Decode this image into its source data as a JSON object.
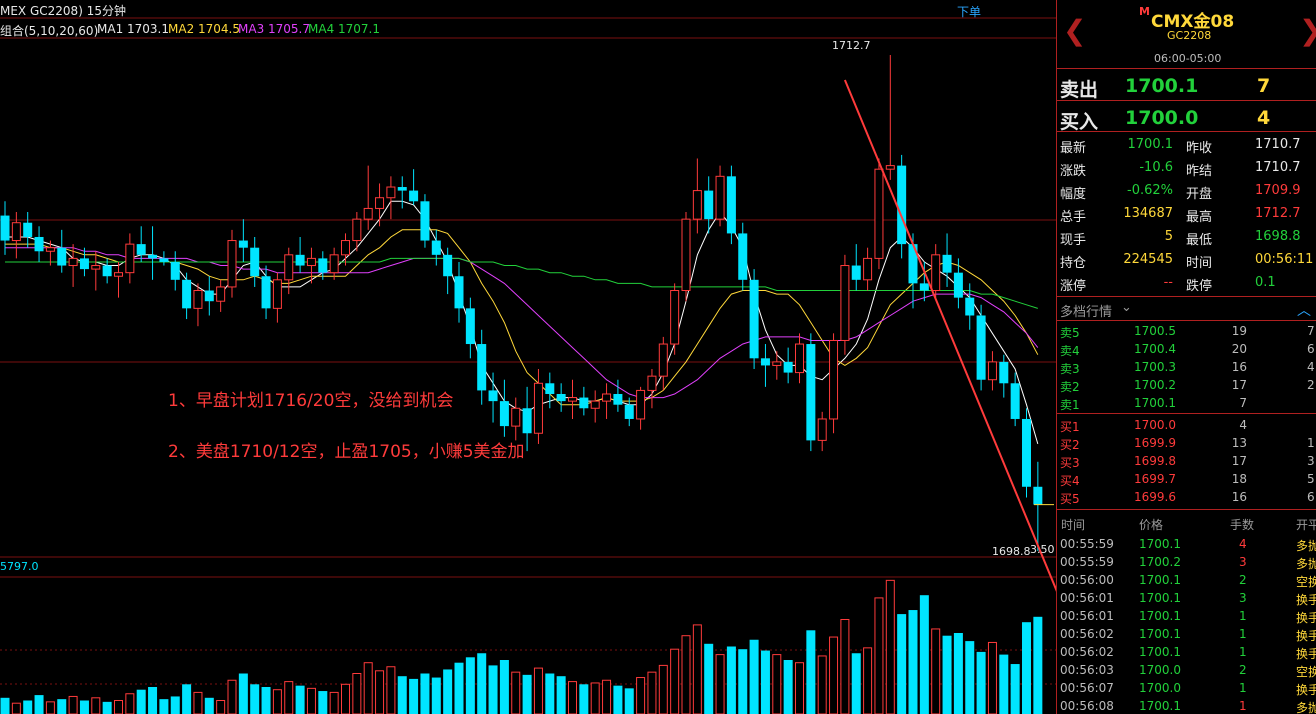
{
  "chart": {
    "title": "MEX GC2208) 15分钟",
    "order_button": "下单",
    "ma_group": "组合(5,10,20,60)",
    "ma1": "MA1 1703.1",
    "ma2": "MA2 1704.5",
    "ma3": "MA3 1705.7",
    "ma4": "MA4 1707.1",
    "high_label": "1712.7",
    "low_label": "1698.8",
    "side_label": "3.50",
    "vol_label": "5797.0",
    "note1": "1、早盘计划1716/20空，没给到机会",
    "note2": "2、美盘1710/12空，止盈1705，小赚5美金加",
    "colors": {
      "up": "#ff3b3b",
      "down": "#00e5ff",
      "ma1": "#ffffff",
      "ma2": "#ffd83a",
      "ma3": "#e040fb",
      "ma4": "#22d13b",
      "grid": "#7a1010",
      "note": "#ff3b3b"
    }
  },
  "chart_data": {
    "type": "candlestick",
    "title": "GC2208 15分钟",
    "ma": {
      "MA1": 1703.1,
      "MA2": 1704.5,
      "MA3": 1705.7,
      "MA4": 1707.1
    },
    "high": 1712.7,
    "low": 1698.8,
    "candles": [
      [
        1708.2,
        1708.6,
        1707.1,
        1707.5
      ],
      [
        1707.5,
        1708.3,
        1707.0,
        1708.0
      ],
      [
        1708.0,
        1708.3,
        1707.3,
        1707.6
      ],
      [
        1707.6,
        1707.9,
        1706.9,
        1707.2
      ],
      [
        1707.2,
        1707.5,
        1706.8,
        1707.3
      ],
      [
        1707.3,
        1707.8,
        1706.6,
        1706.8
      ],
      [
        1706.8,
        1707.4,
        1706.2,
        1707.0
      ],
      [
        1707.0,
        1707.3,
        1706.5,
        1706.7
      ],
      [
        1706.7,
        1707.2,
        1706.1,
        1706.8
      ],
      [
        1706.8,
        1707.0,
        1706.3,
        1706.5
      ],
      [
        1706.5,
        1706.9,
        1705.9,
        1706.6
      ],
      [
        1706.6,
        1707.7,
        1706.3,
        1707.4
      ],
      [
        1707.4,
        1707.9,
        1706.9,
        1707.1
      ],
      [
        1707.1,
        1707.9,
        1706.4,
        1707.0
      ],
      [
        1707.0,
        1707.2,
        1706.8,
        1706.9
      ],
      [
        1706.9,
        1707.2,
        1706.1,
        1706.4
      ],
      [
        1706.4,
        1706.6,
        1705.3,
        1705.6
      ],
      [
        1705.6,
        1706.3,
        1705.1,
        1706.1
      ],
      [
        1706.1,
        1706.5,
        1705.4,
        1705.8
      ],
      [
        1705.8,
        1706.4,
        1705.5,
        1706.2
      ],
      [
        1706.2,
        1707.8,
        1705.9,
        1707.5
      ],
      [
        1707.5,
        1708.1,
        1706.9,
        1707.3
      ],
      [
        1707.3,
        1707.6,
        1706.2,
        1706.5
      ],
      [
        1706.5,
        1706.8,
        1705.3,
        1705.6
      ],
      [
        1705.6,
        1706.6,
        1705.2,
        1706.4
      ],
      [
        1706.4,
        1707.3,
        1706.0,
        1707.1
      ],
      [
        1707.1,
        1707.6,
        1706.6,
        1706.8
      ],
      [
        1706.8,
        1707.3,
        1706.3,
        1707.0
      ],
      [
        1707.0,
        1707.2,
        1706.4,
        1706.6
      ],
      [
        1706.6,
        1707.3,
        1706.4,
        1707.1
      ],
      [
        1707.1,
        1707.7,
        1706.8,
        1707.5
      ],
      [
        1707.5,
        1708.3,
        1707.2,
        1708.1
      ],
      [
        1708.1,
        1709.6,
        1707.8,
        1708.4
      ],
      [
        1708.4,
        1709.1,
        1707.9,
        1708.7
      ],
      [
        1708.7,
        1709.3,
        1708.1,
        1709.0
      ],
      [
        1709.0,
        1709.3,
        1708.4,
        1708.9
      ],
      [
        1708.9,
        1709.5,
        1708.5,
        1708.6
      ],
      [
        1708.6,
        1708.8,
        1707.3,
        1707.5
      ],
      [
        1707.5,
        1707.8,
        1706.8,
        1707.1
      ],
      [
        1707.1,
        1707.3,
        1706.0,
        1706.5
      ],
      [
        1706.5,
        1706.9,
        1705.2,
        1705.6
      ],
      [
        1705.6,
        1705.9,
        1704.2,
        1704.6
      ],
      [
        1704.6,
        1705.0,
        1702.9,
        1703.3
      ],
      [
        1703.3,
        1703.8,
        1702.4,
        1703.0
      ],
      [
        1703.0,
        1703.6,
        1702.0,
        1702.3
      ],
      [
        1702.3,
        1703.1,
        1701.9,
        1702.8
      ],
      [
        1702.8,
        1703.4,
        1701.6,
        1702.1
      ],
      [
        1702.1,
        1703.9,
        1701.8,
        1703.5
      ],
      [
        1703.5,
        1703.8,
        1702.8,
        1703.2
      ],
      [
        1703.2,
        1703.5,
        1702.7,
        1703.0
      ],
      [
        1703.0,
        1703.6,
        1702.5,
        1703.1
      ],
      [
        1703.1,
        1703.4,
        1702.6,
        1702.8
      ],
      [
        1702.8,
        1703.3,
        1702.4,
        1703.0
      ],
      [
        1703.0,
        1703.5,
        1702.5,
        1703.2
      ],
      [
        1703.2,
        1703.6,
        1702.7,
        1702.9
      ],
      [
        1702.9,
        1703.1,
        1702.3,
        1702.5
      ],
      [
        1702.5,
        1703.4,
        1702.2,
        1703.3
      ],
      [
        1703.3,
        1703.9,
        1702.8,
        1703.7
      ],
      [
        1703.7,
        1704.8,
        1703.3,
        1704.6
      ],
      [
        1704.6,
        1706.3,
        1704.3,
        1706.1
      ],
      [
        1706.1,
        1708.3,
        1705.8,
        1708.1
      ],
      [
        1708.1,
        1709.8,
        1707.7,
        1708.9
      ],
      [
        1708.9,
        1709.3,
        1707.7,
        1708.1
      ],
      [
        1708.1,
        1709.6,
        1707.9,
        1709.3
      ],
      [
        1709.3,
        1709.6,
        1707.4,
        1707.7
      ],
      [
        1707.7,
        1708.0,
        1706.1,
        1706.4
      ],
      [
        1706.4,
        1706.7,
        1703.9,
        1704.2
      ],
      [
        1704.2,
        1704.6,
        1703.4,
        1704.0
      ],
      [
        1704.0,
        1704.4,
        1703.6,
        1704.1
      ],
      [
        1704.1,
        1704.5,
        1703.5,
        1703.8
      ],
      [
        1703.8,
        1704.9,
        1703.5,
        1704.6
      ],
      [
        1704.6,
        1704.9,
        1701.6,
        1701.9
      ],
      [
        1701.9,
        1702.7,
        1701.6,
        1702.5
      ],
      [
        1702.5,
        1704.9,
        1702.1,
        1704.7
      ],
      [
        1704.7,
        1707.1,
        1704.3,
        1706.8
      ],
      [
        1706.8,
        1707.4,
        1706.1,
        1706.4
      ],
      [
        1706.4,
        1707.3,
        1706.1,
        1707.0
      ],
      [
        1707.0,
        1709.8,
        1706.7,
        1709.5
      ],
      [
        1709.5,
        1712.7,
        1709.2,
        1709.6
      ],
      [
        1709.6,
        1709.9,
        1707.0,
        1707.4
      ],
      [
        1707.4,
        1707.7,
        1705.6,
        1706.3
      ],
      [
        1706.3,
        1706.9,
        1705.8,
        1706.1
      ],
      [
        1706.1,
        1707.4,
        1705.9,
        1707.1
      ],
      [
        1707.1,
        1707.7,
        1706.2,
        1706.6
      ],
      [
        1706.6,
        1707.0,
        1705.6,
        1705.9
      ],
      [
        1705.9,
        1706.3,
        1705.0,
        1705.4
      ],
      [
        1705.4,
        1705.7,
        1703.3,
        1703.6
      ],
      [
        1703.6,
        1704.4,
        1703.3,
        1704.1
      ],
      [
        1704.1,
        1704.3,
        1703.1,
        1703.5
      ],
      [
        1703.5,
        1703.8,
        1702.3,
        1702.5
      ],
      [
        1702.5,
        1702.8,
        1700.3,
        1700.6
      ],
      [
        1700.6,
        1701.3,
        1698.8,
        1700.1
      ]
    ],
    "ma_series": {
      "MA1": [
        1707.6,
        1707.6,
        1707.6,
        1707.5,
        1707.4,
        1707.3,
        1707.0,
        1706.9,
        1706.9,
        1706.8,
        1706.8,
        1707.0,
        1707.1,
        1707.1,
        1707.0,
        1706.8,
        1706.4,
        1706.2,
        1706.0,
        1706.0,
        1706.4,
        1706.8,
        1706.9,
        1706.5,
        1706.2,
        1706.2,
        1706.2,
        1706.4,
        1706.6,
        1706.7,
        1707.0,
        1707.3,
        1707.7,
        1708.1,
        1708.6,
        1708.6,
        1708.5,
        1708.1,
        1707.5,
        1706.9,
        1706.0,
        1705.1,
        1704.0,
        1703.5,
        1703.0,
        1702.8,
        1702.7,
        1702.9,
        1703.0,
        1703.1,
        1703.1,
        1703.0,
        1703.0,
        1703.1,
        1703.0,
        1702.9,
        1702.9,
        1703.2,
        1703.8,
        1704.6,
        1705.8,
        1707.1,
        1707.8,
        1708.3,
        1707.9,
        1707.3,
        1706.0,
        1705.0,
        1704.3,
        1704.0,
        1704.0,
        1703.7,
        1703.6,
        1703.9,
        1704.2,
        1704.6,
        1705.3,
        1706.4,
        1707.3,
        1707.6,
        1707.3,
        1706.9,
        1706.7,
        1706.5,
        1706.2,
        1705.9,
        1705.4,
        1704.9,
        1704.4,
        1703.9,
        1702.9,
        1701.8
      ],
      "MA2": [
        1707.4,
        1707.4,
        1707.4,
        1707.4,
        1707.3,
        1707.3,
        1707.2,
        1707.1,
        1707.1,
        1707.0,
        1706.9,
        1706.9,
        1706.9,
        1706.9,
        1706.9,
        1706.9,
        1706.8,
        1706.7,
        1706.5,
        1706.4,
        1706.4,
        1706.4,
        1706.5,
        1706.4,
        1706.3,
        1706.3,
        1706.4,
        1706.5,
        1706.5,
        1706.5,
        1706.5,
        1706.8,
        1707.1,
        1707.3,
        1707.6,
        1707.8,
        1707.8,
        1707.8,
        1707.8,
        1707.7,
        1707.3,
        1706.9,
        1706.3,
        1705.8,
        1705.2,
        1704.4,
        1703.8,
        1703.5,
        1703.2,
        1702.9,
        1702.9,
        1702.9,
        1703.0,
        1703.1,
        1703.0,
        1703.0,
        1703.0,
        1703.1,
        1703.3,
        1703.7,
        1704.1,
        1704.6,
        1705.1,
        1705.6,
        1706.0,
        1706.1,
        1706.1,
        1706.1,
        1706.0,
        1706.0,
        1705.7,
        1705.2,
        1704.7,
        1704.2,
        1704.0,
        1704.2,
        1704.5,
        1705.1,
        1705.7,
        1706.0,
        1706.3,
        1706.6,
        1706.8,
        1706.9,
        1706.8,
        1706.6,
        1706.4,
        1706.1,
        1705.8,
        1705.4,
        1704.9,
        1704.3
      ],
      "MA3": [
        1707.3,
        1707.3,
        1707.3,
        1707.3,
        1707.3,
        1707.3,
        1707.3,
        1707.2,
        1707.2,
        1707.1,
        1707.1,
        1707.0,
        1707.0,
        1707.0,
        1707.0,
        1707.0,
        1707.0,
        1706.9,
        1706.9,
        1706.8,
        1706.8,
        1706.7,
        1706.7,
        1706.7,
        1706.6,
        1706.6,
        1706.6,
        1706.6,
        1706.6,
        1706.6,
        1706.6,
        1706.6,
        1706.6,
        1706.7,
        1706.8,
        1706.9,
        1707.0,
        1707.0,
        1707.0,
        1707.0,
        1707.0,
        1706.9,
        1706.7,
        1706.5,
        1706.3,
        1706.0,
        1705.7,
        1705.4,
        1705.1,
        1704.8,
        1704.5,
        1704.2,
        1703.9,
        1703.6,
        1703.4,
        1703.2,
        1703.1,
        1703.1,
        1703.1,
        1703.2,
        1703.4,
        1703.6,
        1703.9,
        1704.2,
        1704.4,
        1704.6,
        1704.7,
        1704.8,
        1704.8,
        1704.8,
        1704.8,
        1704.7,
        1704.7,
        1704.7,
        1704.7,
        1704.8,
        1705.0,
        1705.2,
        1705.4,
        1705.6,
        1705.8,
        1705.9,
        1706.0,
        1706.0,
        1706.0,
        1706.0,
        1705.9,
        1705.7,
        1705.5,
        1705.2,
        1704.9,
        1704.5
      ],
      "MA4": [
        1706.9,
        1706.9,
        1706.9,
        1706.9,
        1706.9,
        1706.9,
        1706.9,
        1706.9,
        1706.9,
        1706.9,
        1706.9,
        1706.9,
        1706.9,
        1706.9,
        1706.9,
        1706.9,
        1706.9,
        1706.9,
        1706.9,
        1706.9,
        1706.9,
        1706.9,
        1706.9,
        1706.9,
        1706.9,
        1706.9,
        1706.9,
        1706.9,
        1706.9,
        1706.9,
        1706.9,
        1706.9,
        1706.9,
        1706.9,
        1707.0,
        1707.0,
        1707.0,
        1707.0,
        1707.0,
        1707.0,
        1707.0,
        1706.9,
        1706.9,
        1706.9,
        1706.8,
        1706.8,
        1706.7,
        1706.7,
        1706.6,
        1706.6,
        1706.5,
        1706.5,
        1706.4,
        1706.4,
        1706.3,
        1706.3,
        1706.3,
        1706.2,
        1706.2,
        1706.2,
        1706.2,
        1706.2,
        1706.2,
        1706.2,
        1706.2,
        1706.2,
        1706.2,
        1706.2,
        1706.1,
        1706.1,
        1706.1,
        1706.1,
        1706.1,
        1706.1,
        1706.1,
        1706.1,
        1706.1,
        1706.1,
        1706.1,
        1706.1,
        1706.1,
        1706.1,
        1706.1,
        1706.1,
        1706.1,
        1706.1,
        1706.0,
        1706.0,
        1705.9,
        1705.8,
        1705.7,
        1705.6
      ]
    },
    "volume": [
      12,
      8,
      10,
      14,
      9,
      11,
      13,
      10,
      12,
      9,
      10,
      15,
      18,
      20,
      11,
      13,
      22,
      16,
      12,
      10,
      25,
      30,
      22,
      20,
      18,
      24,
      21,
      19,
      17,
      16,
      22,
      30,
      38,
      32,
      35,
      28,
      26,
      30,
      27,
      33,
      38,
      42,
      45,
      36,
      40,
      31,
      29,
      34,
      30,
      28,
      24,
      22,
      23,
      25,
      21,
      19,
      27,
      31,
      36,
      48,
      58,
      66,
      52,
      44,
      50,
      48,
      55,
      47,
      44,
      40,
      38,
      62,
      43,
      57,
      70,
      45,
      49,
      86,
      99,
      74,
      77,
      88,
      63,
      58,
      60,
      54,
      46,
      53,
      44,
      37,
      68,
      72
    ]
  },
  "panel": {
    "symbol_mark": "M",
    "symbol": "CMX金08",
    "code": "GC2208",
    "session": "06:00-05:00",
    "sell_label": "卖出",
    "sell_price": "1700.1",
    "sell_qty": "7",
    "buy_label": "买入",
    "buy_price": "1700.0",
    "buy_qty": "4",
    "stats": [
      {
        "l1": "最新",
        "v1": "1700.1",
        "c1": "green",
        "l2": "昨收",
        "v2": "1710.7",
        "c2": "white"
      },
      {
        "l1": "涨跌",
        "v1": "-10.6",
        "c1": "green",
        "l2": "昨结",
        "v2": "1710.7",
        "c2": "white"
      },
      {
        "l1": "幅度",
        "v1": "-0.62%",
        "c1": "green",
        "l2": "开盘",
        "v2": "1709.9",
        "c2": "red"
      },
      {
        "l1": "总手",
        "v1": "134687",
        "c1": "yellow",
        "l2": "最高",
        "v2": "1712.7",
        "c2": "red"
      },
      {
        "l1": "现手",
        "v1": "5",
        "c1": "yellow",
        "l2": "最低",
        "v2": "1698.8",
        "c2": "green"
      },
      {
        "l1": "持仓",
        "v1": "224545",
        "c1": "yellow",
        "l2": "时间",
        "v2": "00:56:11",
        "c2": "yellow"
      },
      {
        "l1": "涨停",
        "v1": "--",
        "c1": "red",
        "l2": "跌停",
        "v2": "0.1",
        "c2": "green"
      }
    ],
    "depth_title": "多档行情",
    "asks": [
      {
        "label": "卖5",
        "price": "1700.5",
        "qty": "19",
        "x": "7"
      },
      {
        "label": "卖4",
        "price": "1700.4",
        "qty": "20",
        "x": "6"
      },
      {
        "label": "卖3",
        "price": "1700.3",
        "qty": "16",
        "x": "4"
      },
      {
        "label": "卖2",
        "price": "1700.2",
        "qty": "17",
        "x": "2"
      },
      {
        "label": "卖1",
        "price": "1700.1",
        "qty": "7",
        "x": ""
      }
    ],
    "bids": [
      {
        "label": "买1",
        "price": "1700.0",
        "qty": "4",
        "x": ""
      },
      {
        "label": "买2",
        "price": "1699.9",
        "qty": "13",
        "x": "1"
      },
      {
        "label": "买3",
        "price": "1699.8",
        "qty": "17",
        "x": "3"
      },
      {
        "label": "买4",
        "price": "1699.7",
        "qty": "18",
        "x": "5"
      },
      {
        "label": "买5",
        "price": "1699.6",
        "qty": "16",
        "x": "6"
      }
    ],
    "ticks_header": {
      "time": "时间",
      "price": "价格",
      "qty": "手数",
      "type": "开平"
    },
    "ticks": [
      {
        "time": "00:55:59",
        "price": "1700.1",
        "qty": "4",
        "qc": "red",
        "type": "多抛"
      },
      {
        "time": "00:55:59",
        "price": "1700.2",
        "qty": "3",
        "qc": "red",
        "type": "多抛"
      },
      {
        "time": "00:56:00",
        "price": "1700.1",
        "qty": "2",
        "qc": "green",
        "type": "空换"
      },
      {
        "time": "00:56:01",
        "price": "1700.1",
        "qty": "3",
        "qc": "green",
        "type": "换手"
      },
      {
        "time": "00:56:01",
        "price": "1700.1",
        "qty": "1",
        "qc": "green",
        "type": "换手"
      },
      {
        "time": "00:56:02",
        "price": "1700.1",
        "qty": "1",
        "qc": "green",
        "type": "换手"
      },
      {
        "time": "00:56:02",
        "price": "1700.1",
        "qty": "1",
        "qc": "green",
        "type": "换手"
      },
      {
        "time": "00:56:03",
        "price": "1700.0",
        "qty": "2",
        "qc": "green",
        "type": "空换"
      },
      {
        "time": "00:56:07",
        "price": "1700.0",
        "qty": "1",
        "qc": "green",
        "type": "换手"
      },
      {
        "time": "00:56:08",
        "price": "1700.1",
        "qty": "1",
        "qc": "red",
        "type": "多抛"
      }
    ]
  }
}
